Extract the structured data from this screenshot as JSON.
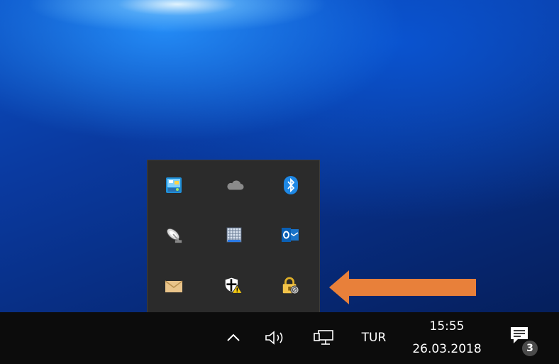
{
  "tray": {
    "icons": [
      {
        "name": "network-monitor-icon"
      },
      {
        "name": "onedrive-icon"
      },
      {
        "name": "bluetooth-icon"
      },
      {
        "name": "satellite-dish-icon"
      },
      {
        "name": "grid-app-icon"
      },
      {
        "name": "outlook-icon"
      },
      {
        "name": "mail-icon"
      },
      {
        "name": "windows-defender-warning-icon"
      },
      {
        "name": "lock-blocked-icon"
      }
    ]
  },
  "annotation": {
    "arrow_color": "#e8803a"
  },
  "taskbar": {
    "language": "TUR",
    "time": "15:55",
    "date": "26.03.2018",
    "notification_count": "3"
  },
  "colors": {
    "taskbar": "#0c0c0c",
    "flyout": "#2b2b2b",
    "accent_blue": "#0078d7"
  }
}
